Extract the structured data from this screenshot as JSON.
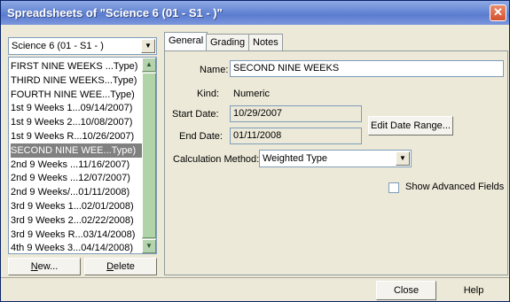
{
  "window": {
    "title": "Spreadsheets of \"Science 6 (01 - S1 - )\""
  },
  "class_selector": {
    "value": "Science 6 (01 - S1 - )"
  },
  "spreadsheet_list": {
    "items": [
      "FIRST NINE WEEKS ...Type)",
      "THIRD NINE WEEKS...Type)",
      "FOURTH NINE WEE...Type)",
      "1st 9 Weeks 1...09/14/2007)",
      "1st 9 Weeks 2...10/08/2007)",
      "1st 9 Weeks R...10/26/2007)",
      "SECOND NINE WEE...Type)",
      "2nd 9 Weeks ...11/16/2007)",
      "2nd 9 Weeks ...12/07/2007)",
      "2nd 9 Weeks/...01/11/2008)",
      "3rd 9 Weeks 1...02/01/2008)",
      "3rd 9 Weeks 2...02/22/2008)",
      "3rd 9 Weeks R...03/14/2008)",
      "4th 9 Weeks 3...04/14/2008)"
    ],
    "selected_index": 6
  },
  "buttons": {
    "new": "New...",
    "delete": "Delete",
    "edit_date_range": "Edit Date Range...",
    "close": "Close",
    "help": "Help"
  },
  "tabs": [
    "General",
    "Grading",
    "Notes"
  ],
  "general": {
    "name_label": "Name:",
    "name_value": "SECOND NINE WEEKS",
    "kind_label": "Kind:",
    "kind_value": "Numeric",
    "start_label": "Start Date:",
    "start_value": "10/29/2007",
    "end_label": "End Date:",
    "end_value": "01/11/2008",
    "calc_label": "Calculation Method:",
    "calc_value": "Weighted Type",
    "advanced_label": "Show Advanced Fields",
    "advanced_checked": false
  }
}
